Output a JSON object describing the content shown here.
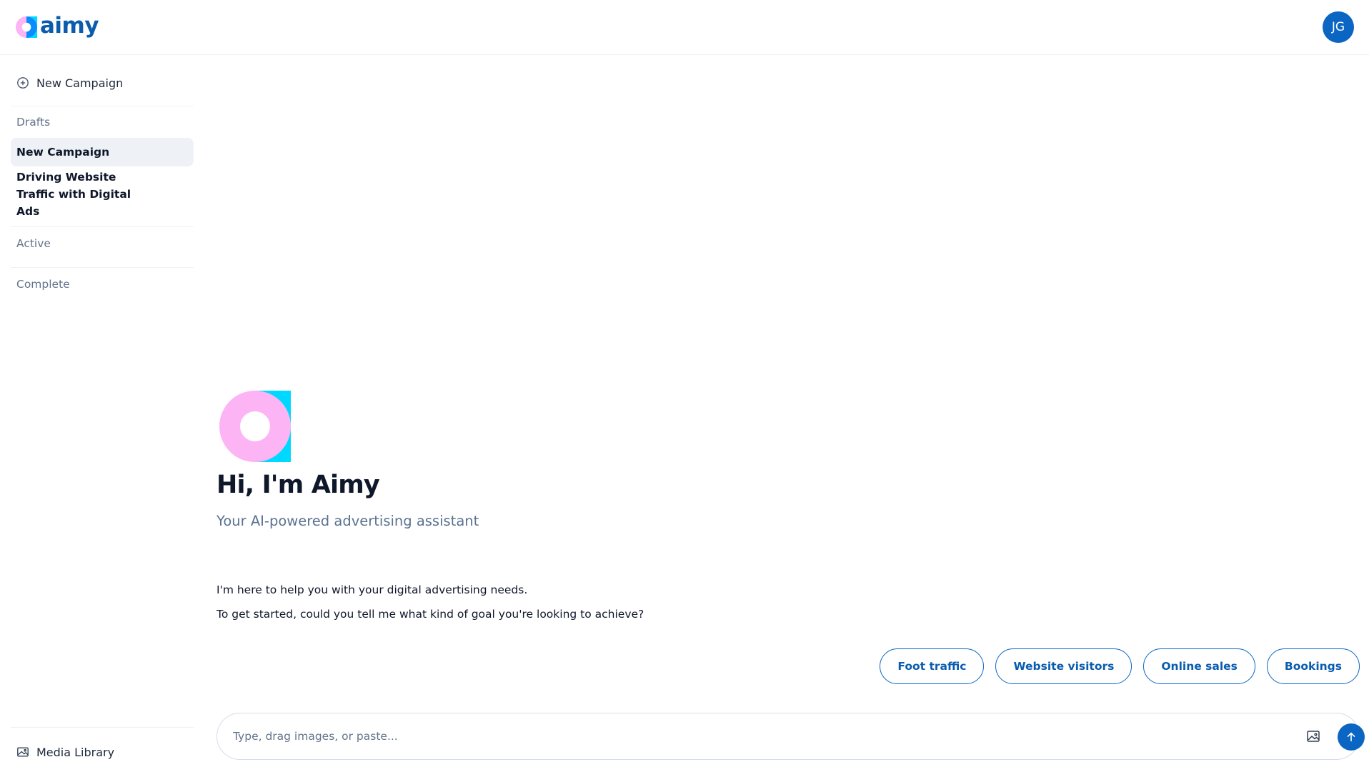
{
  "header": {
    "brand": "aimy",
    "user_initials": "JG"
  },
  "sidebar": {
    "new_campaign_label": "New Campaign",
    "drafts_label": "Drafts",
    "drafts": [
      {
        "label": "New Campaign",
        "selected": true
      },
      {
        "label": "Driving Website Traffic with Digital Ads",
        "selected": false
      }
    ],
    "active_label": "Active",
    "complete_label": "Complete",
    "media_library_label": "Media Library"
  },
  "main": {
    "title": "Hi, I'm Aimy",
    "subtitle": "Your AI-powered advertising assistant",
    "messages": [
      "I'm here to help you with your digital advertising needs.",
      "To get started, could you tell me what kind of goal you're looking to achieve?"
    ],
    "suggestions": [
      "Foot traffic",
      "Website visitors",
      "Online sales",
      "Bookings"
    ],
    "composer": {
      "placeholder": "Type, drag images, or paste..."
    }
  },
  "colors": {
    "brand_blue": "#0a66c2",
    "logo_pink": "#fdb4f5",
    "logo_blue": "#0a8cff",
    "logo_cyan": "#00d9ff"
  }
}
